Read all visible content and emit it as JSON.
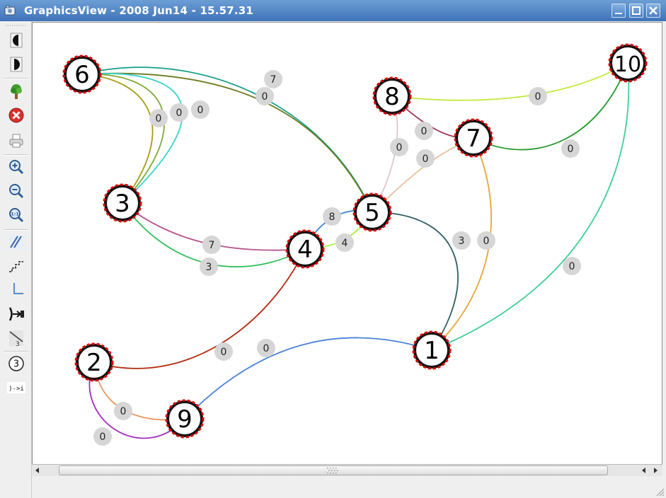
{
  "window": {
    "title": "GraphicsView - 2008 Jun14 - 15.57.31",
    "controls": [
      "minimize",
      "maximize",
      "close"
    ]
  },
  "toolbar": {
    "tools": [
      {
        "name": "step-back",
        "icon": "half-circle-left-icon"
      },
      {
        "name": "step-forward",
        "icon": "half-circle-right-icon"
      },
      {
        "name": "tree",
        "icon": "tree-icon"
      },
      {
        "name": "delete",
        "icon": "delete-icon"
      },
      {
        "name": "print",
        "icon": "printer-icon"
      },
      {
        "name": "zoom-in",
        "icon": "zoom-in-icon"
      },
      {
        "name": "zoom-out",
        "icon": "zoom-out-icon"
      },
      {
        "name": "zoom-1-1",
        "icon": "zoom-actual-size-icon",
        "label": "1:1"
      },
      {
        "name": "straight-edges",
        "icon": "diagonal-lines-icon"
      },
      {
        "name": "polyline-edges",
        "icon": "staircase-icon"
      },
      {
        "name": "orthogonal",
        "icon": "orthogonal-icon"
      },
      {
        "name": "edge-direction",
        "icon": "arrow-into-bracket-icon"
      },
      {
        "name": "edge-weight",
        "icon": "weighted-edge-icon",
        "label": "3"
      },
      {
        "name": "vertex-label",
        "icon": "circled-number-icon",
        "label": "3"
      },
      {
        "name": "arrow-label",
        "icon": "arrow-text-icon",
        "label": ")->i"
      }
    ]
  },
  "graph": {
    "nodes": [
      {
        "id": "1",
        "label": "1"
      },
      {
        "id": "2",
        "label": "2"
      },
      {
        "id": "3",
        "label": "3"
      },
      {
        "id": "4",
        "label": "4"
      },
      {
        "id": "5",
        "label": "5"
      },
      {
        "id": "6",
        "label": "6"
      },
      {
        "id": "7",
        "label": "7"
      },
      {
        "id": "8",
        "label": "8"
      },
      {
        "id": "9",
        "label": "9"
      },
      {
        "id": "10",
        "label": "10"
      }
    ],
    "edges": [
      {
        "from": "6",
        "to": "5",
        "weight": "7",
        "color": "#169e8a"
      },
      {
        "from": "6",
        "to": "5",
        "weight": "0",
        "color": "#6b7a1c"
      },
      {
        "from": "6",
        "to": "3",
        "weight": "0",
        "color": "#a89b16"
      },
      {
        "from": "6",
        "to": "3",
        "weight": "0",
        "color": "#7fab3a"
      },
      {
        "from": "6",
        "to": "3",
        "weight": "0",
        "color": "#35d4c8"
      },
      {
        "from": "8",
        "to": "10",
        "weight": "0",
        "color": "#c2ea3a"
      },
      {
        "from": "8",
        "to": "7",
        "weight": "0",
        "color": "#9c3350"
      },
      {
        "from": "8",
        "to": "5",
        "weight": "0",
        "color": "#e2c4cf"
      },
      {
        "from": "7",
        "to": "5",
        "weight": "0",
        "color": "#e5c29f"
      },
      {
        "from": "7",
        "to": "10",
        "weight": "0",
        "color": "#1f9a28"
      },
      {
        "from": "7",
        "to": "1",
        "weight": "0",
        "color": "#e5a53a"
      },
      {
        "from": "5",
        "to": "1",
        "weight": "3",
        "color": "#2d5e62"
      },
      {
        "from": "5",
        "to": "4",
        "weight": "8",
        "color": "#3a86d1"
      },
      {
        "from": "5",
        "to": "4",
        "weight": "4",
        "color": "#a8ef3a"
      },
      {
        "from": "3",
        "to": "4",
        "weight": "7",
        "color": "#b9558e"
      },
      {
        "from": "3",
        "to": "4",
        "weight": "3",
        "color": "#2fbf5a"
      },
      {
        "from": "10",
        "to": "1",
        "weight": "0",
        "color": "#3fcf92"
      },
      {
        "from": "4",
        "to": "2",
        "weight": "0",
        "color": "#b22a0c"
      },
      {
        "from": "9",
        "to": "1",
        "weight": "0",
        "color": "#4a82d9"
      },
      {
        "from": "2",
        "to": "9",
        "weight": "0",
        "color": "#e8955a"
      },
      {
        "from": "2",
        "to": "9",
        "weight": "0",
        "color": "#a52cbf"
      }
    ]
  },
  "colors": {
    "title_bar": "#4f83c2",
    "node_border_dash": "#e00000",
    "weight_bubble": "#d6d6d6"
  }
}
